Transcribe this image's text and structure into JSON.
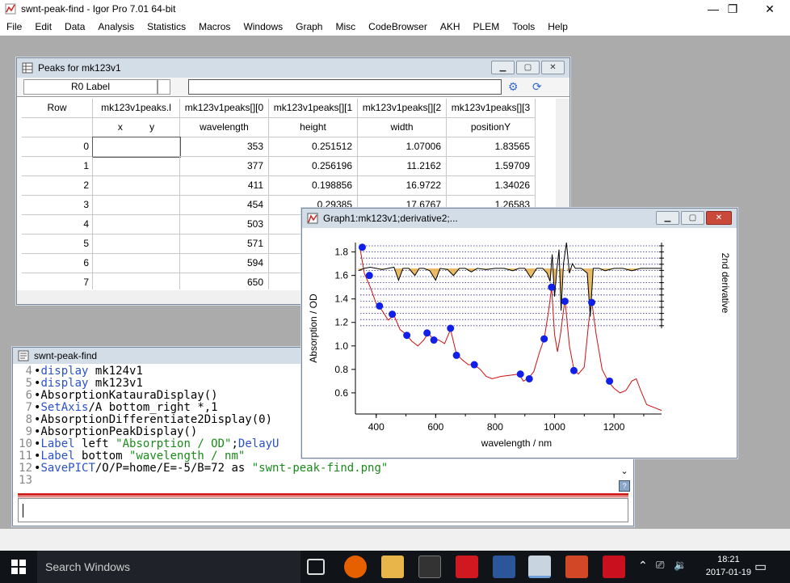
{
  "app": {
    "title": "swnt-peak-find - Igor Pro 7.01 64-bit",
    "minimize": "—",
    "restore": "❐",
    "close": "✕"
  },
  "menu": [
    "File",
    "Edit",
    "Data",
    "Analysis",
    "Statistics",
    "Macros",
    "Windows",
    "Graph",
    "Misc",
    "CodeBrowser",
    "AKH",
    "PLEM",
    "Tools",
    "Help"
  ],
  "table": {
    "title": "Peaks for mk123v1",
    "r0_label": "R0 Label",
    "header1": [
      "Row",
      "mk123v1peaks.l",
      "mk123v1peaks[][0",
      "mk123v1peaks[][1",
      "mk123v1peaks[][2",
      "mk123v1peaks[][3"
    ],
    "header2": [
      "",
      "x          y",
      "wavelength",
      "height",
      "width",
      "positionY"
    ],
    "rows": [
      [
        "0",
        "",
        "353",
        "0.251512",
        "1.07006",
        "1.83565"
      ],
      [
        "1",
        "",
        "377",
        "0.256196",
        "11.2162",
        "1.59709"
      ],
      [
        "2",
        "",
        "411",
        "0.198856",
        "16.9722",
        "1.34026"
      ],
      [
        "3",
        "",
        "454",
        "0.29385",
        "17.6767",
        "1.26583"
      ],
      [
        "4",
        "",
        "503",
        "",
        "",
        ""
      ],
      [
        "5",
        "",
        "571",
        "",
        "",
        ""
      ],
      [
        "6",
        "",
        "594",
        "",
        "",
        ""
      ],
      [
        "7",
        "",
        "650",
        "",
        "",
        ""
      ]
    ]
  },
  "command": {
    "title": "swnt-peak-find",
    "lines": [
      {
        "n": "4",
        "t": "•display mk124v1"
      },
      {
        "n": "5",
        "t": "•display mk123v1"
      },
      {
        "n": "6",
        "t": "•AbsorptionKatauraDisplay()"
      },
      {
        "n": "7",
        "t": "•SetAxis/A bottom_right *,1"
      },
      {
        "n": "8",
        "t": "•AbsorptionDifferentiate2Display(0)"
      },
      {
        "n": "9",
        "t": "•AbsorptionPeakDisplay()"
      },
      {
        "n": "10",
        "t": "•Label left \"Absorption / OD\";DelayU"
      },
      {
        "n": "11",
        "t": "•Label bottom \"wavelength / nm\""
      },
      {
        "n": "12",
        "t": "•SavePICT/O/P=home/E=-5/B=72 as \"swnt-peak-find.png\""
      },
      {
        "n": "13",
        "t": ""
      }
    ]
  },
  "graph": {
    "title": "Graph1:mk123v1;derivative2;...",
    "chart_data": {
      "type": "line",
      "xlabel": "wavelength / nm",
      "ylabel": "Absorption / OD",
      "right_label": "2nd derivative",
      "xlim": [
        330,
        1360
      ],
      "ylim": [
        0.42,
        1.88
      ],
      "xticks": [
        400,
        600,
        800,
        1000,
        1200
      ],
      "yticks": [
        0.6,
        0.8,
        1.0,
        1.2,
        1.4,
        1.6,
        1.8
      ],
      "series": [
        {
          "values": [
            [
              345,
              1.84
            ],
            [
              360,
              1.62
            ],
            [
              380,
              1.5
            ],
            [
              400,
              1.36
            ],
            [
              420,
              1.3
            ],
            [
              440,
              1.22
            ],
            [
              460,
              1.26
            ],
            [
              480,
              1.14
            ],
            [
              500,
              1.1
            ],
            [
              520,
              1.04
            ],
            [
              540,
              1.0
            ],
            [
              560,
              1.05
            ],
            [
              575,
              1.11
            ],
            [
              590,
              1.06
            ],
            [
              610,
              1.05
            ],
            [
              630,
              1.02
            ],
            [
              650,
              1.14
            ],
            [
              670,
              0.93
            ],
            [
              690,
              0.88
            ],
            [
              710,
              0.84
            ],
            [
              730,
              0.84
            ],
            [
              750,
              0.8
            ],
            [
              770,
              0.74
            ],
            [
              790,
              0.72
            ],
            [
              820,
              0.74
            ],
            [
              850,
              0.75
            ],
            [
              880,
              0.76
            ],
            [
              895,
              0.7
            ],
            [
              910,
              0.72
            ],
            [
              930,
              0.78
            ],
            [
              950,
              0.95
            ],
            [
              965,
              1.06
            ],
            [
              980,
              1.3
            ],
            [
              990,
              1.5
            ],
            [
              1000,
              1.1
            ],
            [
              1010,
              0.95
            ],
            [
              1020,
              1.1
            ],
            [
              1035,
              1.4
            ],
            [
              1050,
              1.0
            ],
            [
              1065,
              0.8
            ],
            [
              1080,
              0.76
            ],
            [
              1100,
              0.82
            ],
            [
              1115,
              1.2
            ],
            [
              1125,
              1.38
            ],
            [
              1140,
              1.1
            ],
            [
              1160,
              0.8
            ],
            [
              1180,
              0.7
            ],
            [
              1200,
              0.64
            ],
            [
              1220,
              0.6
            ],
            [
              1240,
              0.62
            ],
            [
              1260,
              0.7
            ],
            [
              1275,
              0.72
            ],
            [
              1290,
              0.62
            ],
            [
              1310,
              0.5
            ],
            [
              1340,
              0.47
            ],
            [
              1360,
              0.45
            ]
          ]
        },
        {
          "values": [
            [
              340,
              1.64
            ],
            [
              360,
              1.66
            ],
            [
              380,
              1.67
            ],
            [
              400,
              1.66
            ],
            [
              420,
              1.65
            ],
            [
              440,
              1.66
            ],
            [
              460,
              1.67
            ],
            [
              475,
              1.56
            ],
            [
              490,
              1.66
            ],
            [
              510,
              1.66
            ],
            [
              530,
              1.6
            ],
            [
              545,
              1.66
            ],
            [
              560,
              1.66
            ],
            [
              580,
              1.64
            ],
            [
              600,
              1.56
            ],
            [
              615,
              1.66
            ],
            [
              640,
              1.65
            ],
            [
              660,
              1.6
            ],
            [
              680,
              1.66
            ],
            [
              700,
              1.66
            ],
            [
              720,
              1.63
            ],
            [
              740,
              1.66
            ],
            [
              770,
              1.65
            ],
            [
              800,
              1.66
            ],
            [
              830,
              1.66
            ],
            [
              860,
              1.64
            ],
            [
              880,
              1.66
            ],
            [
              900,
              1.66
            ],
            [
              920,
              1.58
            ],
            [
              940,
              1.66
            ],
            [
              960,
              1.66
            ],
            [
              975,
              1.62
            ],
            [
              985,
              1.55
            ],
            [
              992,
              1.78
            ],
            [
              1000,
              1.42
            ],
            [
              1008,
              1.66
            ],
            [
              1015,
              1.82
            ],
            [
              1022,
              1.3
            ],
            [
              1030,
              1.7
            ],
            [
              1040,
              1.88
            ],
            [
              1050,
              1.62
            ],
            [
              1060,
              1.7
            ],
            [
              1070,
              1.66
            ],
            [
              1090,
              1.66
            ],
            [
              1110,
              1.62
            ],
            [
              1120,
              1.25
            ],
            [
              1130,
              1.66
            ],
            [
              1150,
              1.66
            ],
            [
              1170,
              1.64
            ],
            [
              1200,
              1.66
            ],
            [
              1230,
              1.66
            ],
            [
              1260,
              1.64
            ],
            [
              1290,
              1.66
            ],
            [
              1320,
              1.66
            ],
            [
              1360,
              1.66
            ]
          ]
        }
      ],
      "markers": [
        [
          353,
          1.84
        ],
        [
          377,
          1.6
        ],
        [
          411,
          1.34
        ],
        [
          454,
          1.27
        ],
        [
          503,
          1.09
        ],
        [
          571,
          1.11
        ],
        [
          594,
          1.05
        ],
        [
          650,
          1.15
        ],
        [
          670,
          0.92
        ],
        [
          730,
          0.84
        ],
        [
          885,
          0.76
        ],
        [
          915,
          0.72
        ],
        [
          965,
          1.06
        ],
        [
          990,
          1.5
        ],
        [
          1035,
          1.38
        ],
        [
          1065,
          0.79
        ],
        [
          1125,
          1.37
        ],
        [
          1185,
          0.7
        ]
      ],
      "colors": {
        "absorption": "#cc1111",
        "derivative": "#000000",
        "marker": "#1020e8",
        "fill": "#e8b04a",
        "guide": "#2a2a8a"
      }
    }
  },
  "taskbar": {
    "search": "Search Windows",
    "time": "18:21",
    "date": "2017-01-19"
  }
}
